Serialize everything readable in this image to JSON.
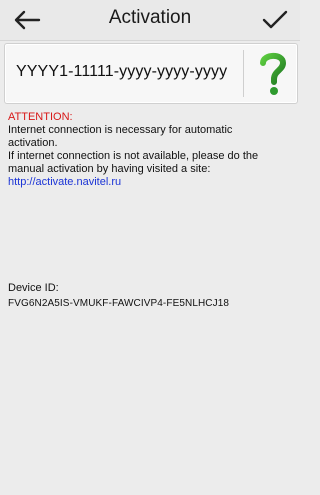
{
  "header": {
    "title": "Activation"
  },
  "activation": {
    "key_value": "YYYY1-11111-yyyy-yyyy-yyyy"
  },
  "info": {
    "attention": "ATTENTION:",
    "line1": "Internet connection is necessary for automatic",
    "line2": "activation.",
    "line3": "If internet connection is not available, please do the",
    "line4": "manual activation by having visited a site:",
    "link": "http://activate.navitel.ru"
  },
  "device": {
    "label": "Device ID:",
    "id": "FVG6N2A5IS-VMUKF-FAWCIVP4-FE5NLHCJ18"
  },
  "icons": {
    "back": "arrow-left-icon",
    "confirm": "checkmark-icon",
    "help": "question-mark-icon"
  },
  "colors": {
    "attention": "#d81818",
    "link": "#1b34d6",
    "help_green": "#2e9a2e"
  }
}
